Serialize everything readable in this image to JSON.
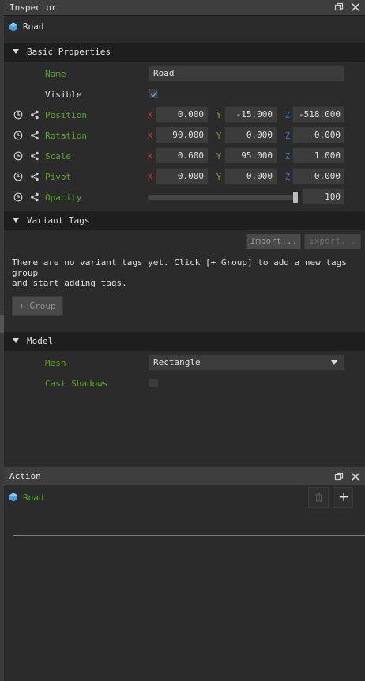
{
  "inspector": {
    "title": "Inspector",
    "object_name": "Road",
    "basic": {
      "section_label": "Basic Properties",
      "name_label": "Name",
      "name_value": "Road",
      "visible_label": "Visible",
      "visible_checked": true,
      "position": {
        "label": "Position",
        "x": "0.000",
        "y": "-15.000",
        "z": "-518.000"
      },
      "rotation": {
        "label": "Rotation",
        "x": "90.000",
        "y": "0.000",
        "z": "0.000"
      },
      "scale": {
        "label": "Scale",
        "x": "0.600",
        "y": "95.000",
        "z": "1.000"
      },
      "pivot": {
        "label": "Pivot",
        "x": "0.000",
        "y": "0.000",
        "z": "0.000"
      },
      "opacity": {
        "label": "Opacity",
        "value": "100",
        "level_percent": 100
      },
      "axis_x": "X",
      "axis_y": "Y",
      "axis_z": "Z"
    },
    "variant_tags": {
      "section_label": "Variant Tags",
      "import_label": "Import...",
      "export_label": "Export...",
      "message": "There are no variant tags yet. Click [+ Group] to add a new tags group\nand start adding tags.",
      "group_button_label": "+ Group"
    },
    "model": {
      "section_label": "Model",
      "mesh_label": "Mesh",
      "mesh_value": "Rectangle",
      "cast_shadows_label": "Cast Shadows",
      "cast_shadows_checked": false
    }
  },
  "action": {
    "title": "Action",
    "object_name": "Road",
    "add_label": "+"
  },
  "colors": {
    "label_green": "#5ba52e",
    "axis_x": "#b83a2e",
    "axis_y": "#6fa23a",
    "axis_z": "#2e74b8",
    "cube_blue": "#4aa3e6",
    "check_blue": "#5aa0e6"
  },
  "icons": {
    "cube": "cube-icon",
    "clock": "clock-icon",
    "share": "link-icon",
    "restore": "restore-window-icon",
    "close": "close-icon",
    "delete": "trash-icon",
    "add": "plus-icon"
  }
}
